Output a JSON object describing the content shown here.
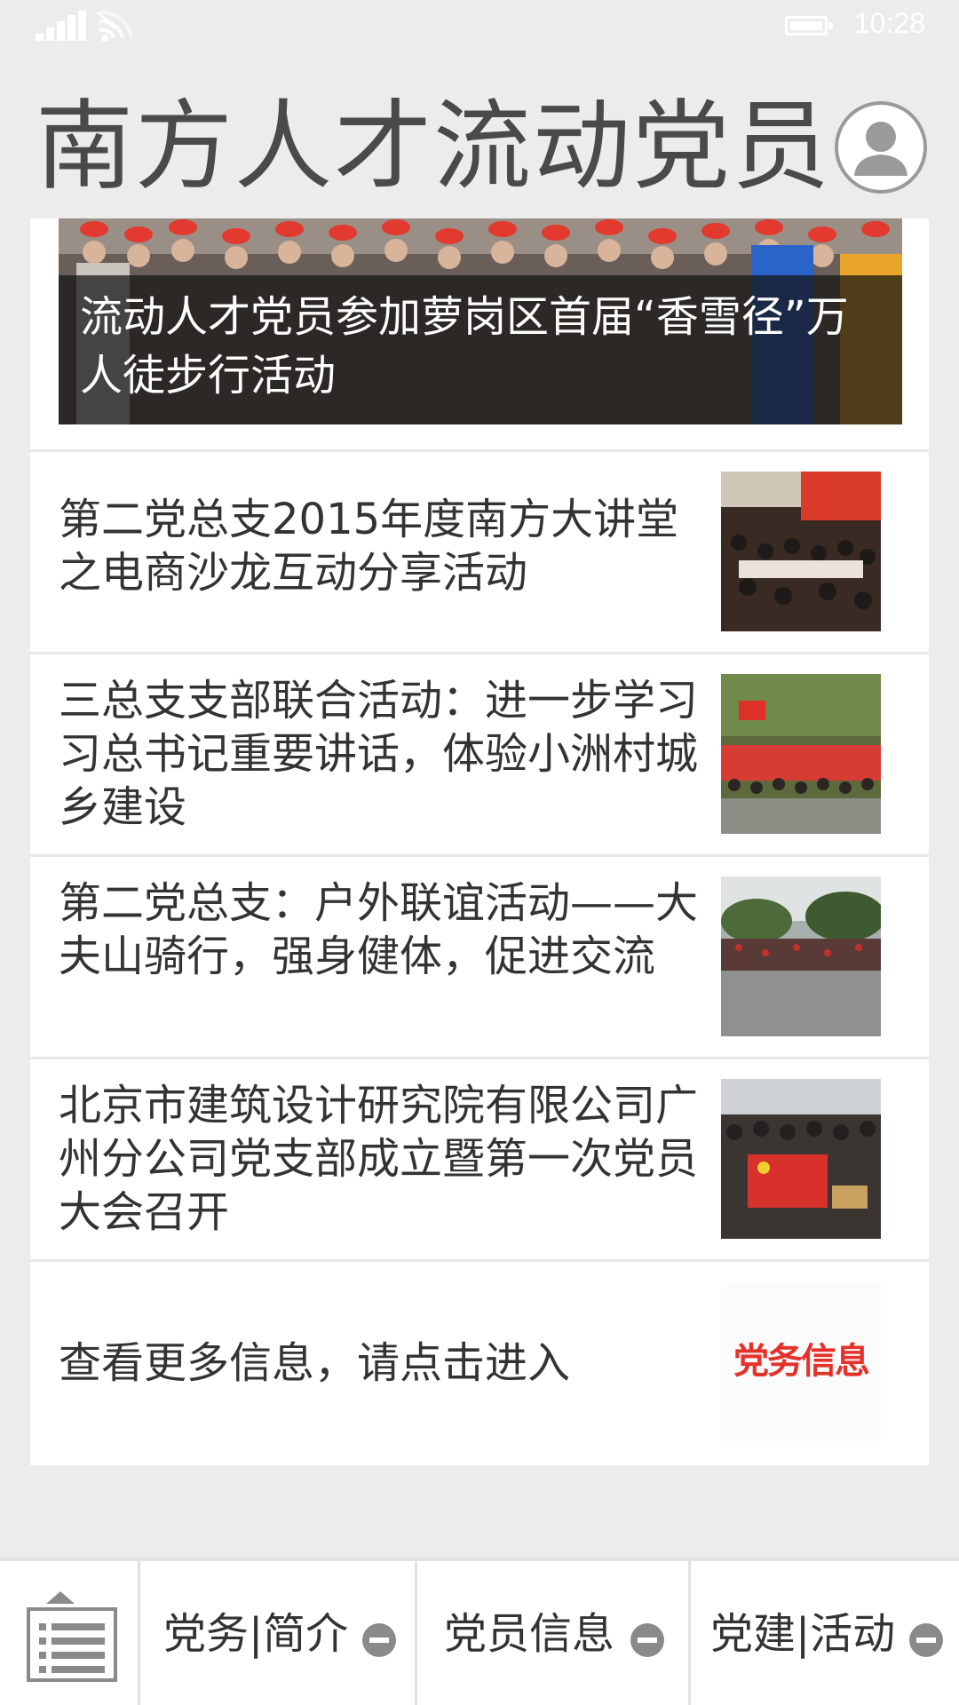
{
  "status_bar": {
    "time": "10:28"
  },
  "header": {
    "title": "南方人才流动党员"
  },
  "hero": {
    "caption": "流动人才党员参加萝岗区首届“香雪径”万人徒步行活动"
  },
  "news": [
    {
      "title": "第二党总支2015年度南方大讲堂之电商沙龙互动分享活动",
      "thumb": "meeting-photo"
    },
    {
      "title": "三总支支部联合活动：进一步学习习总书记重要讲话，体验小洲村城乡建设",
      "thumb": "group-photo-flags"
    },
    {
      "title": "第二党总支：户外联谊活动——大夫山骑行，强身健体，促进交流",
      "thumb": "outdoor-group-photo"
    },
    {
      "title": "北京市建筑设计研究院有限公司广州分公司党支部成立暨第一次党员大会召开",
      "thumb": "party-flag-photo"
    },
    {
      "title": "查看更多信息，请点击进入",
      "thumb": "dangwu-xinxi-logo",
      "thumb_text": "党务信息"
    }
  ],
  "bottom_nav": {
    "items": [
      {
        "label": "党务|简介",
        "icon": "minus-circle-icon"
      },
      {
        "label": "党员信息",
        "icon": "minus-circle-icon"
      },
      {
        "label": "党建|活动",
        "icon": "minus-circle-icon"
      }
    ]
  },
  "colors": {
    "background": "#ececec",
    "card": "#ffffff",
    "title_text": "#4a4a4a",
    "body_text": "#333333",
    "accent_red": "#e4322b"
  }
}
